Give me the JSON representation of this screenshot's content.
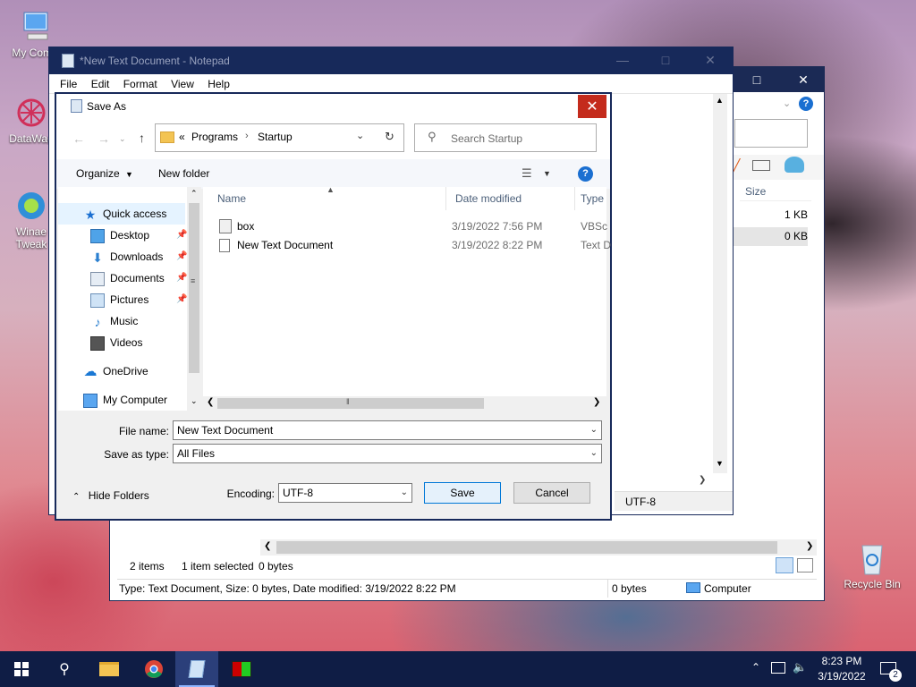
{
  "desktop": {
    "icons": [
      {
        "label": "My Comp"
      },
      {
        "label": "DataWag"
      },
      {
        "label": "Winae Tweak"
      },
      {
        "label": "Recycle Bin"
      }
    ]
  },
  "explorer": {
    "size_header": "Size",
    "sizes": [
      "1 KB",
      "0 KB"
    ],
    "status_items": "2 items",
    "status_selected": "1 item selected",
    "status_bytes": "0 bytes",
    "details_bar": "Type: Text Document, Size: 0 bytes, Date modified: 3/19/2022 8:22 PM",
    "details_bytes": "0 bytes",
    "details_location": "Computer"
  },
  "notepad": {
    "title": "*New Text Document - Notepad",
    "menu": [
      "File",
      "Edit",
      "Format",
      "View",
      "Help"
    ],
    "status_encoding": "UTF-8"
  },
  "dialog": {
    "title": "Save As",
    "breadcrumb": {
      "prefix": "«",
      "items": [
        "Programs",
        "Startup"
      ]
    },
    "search_placeholder": "Search Startup",
    "toolbar": {
      "organize": "Organize",
      "new_folder": "New folder"
    },
    "nav": [
      {
        "label": "Quick access",
        "icon": "star-icon",
        "pinned": false
      },
      {
        "label": "Desktop",
        "icon": "desktop-icon",
        "pinned": true
      },
      {
        "label": "Downloads",
        "icon": "download-icon",
        "pinned": true
      },
      {
        "label": "Documents",
        "icon": "documents-icon",
        "pinned": true
      },
      {
        "label": "Pictures",
        "icon": "pictures-icon",
        "pinned": true
      },
      {
        "label": "Music",
        "icon": "music-icon",
        "pinned": false
      },
      {
        "label": "Videos",
        "icon": "videos-icon",
        "pinned": false
      },
      {
        "label": "OneDrive",
        "icon": "cloud-icon",
        "pinned": false
      },
      {
        "label": "My Computer",
        "icon": "computer-icon",
        "pinned": false
      }
    ],
    "columns": [
      "Name",
      "Date modified",
      "Type"
    ],
    "files": [
      {
        "name": "box",
        "date": "3/19/2022 7:56 PM",
        "type": "VBSc"
      },
      {
        "name": "New Text Document",
        "date": "3/19/2022 8:22 PM",
        "type": "Text D"
      }
    ],
    "file_name_label": "File name:",
    "file_name_value": "New Text Document",
    "save_type_label": "Save as type:",
    "save_type_value": "All Files",
    "encoding_label": "Encoding:",
    "encoding_value": "UTF-8",
    "save_label": "Save",
    "cancel_label": "Cancel",
    "hide_folders_label": "Hide Folders"
  },
  "taskbar": {
    "time": "8:23 PM",
    "date": "3/19/2022",
    "notification_count": "2"
  },
  "colors": {
    "titlebar": "#17295a",
    "taskbar": "#0f1d45",
    "close_red": "#c42b1c",
    "accent": "#0078d7"
  }
}
